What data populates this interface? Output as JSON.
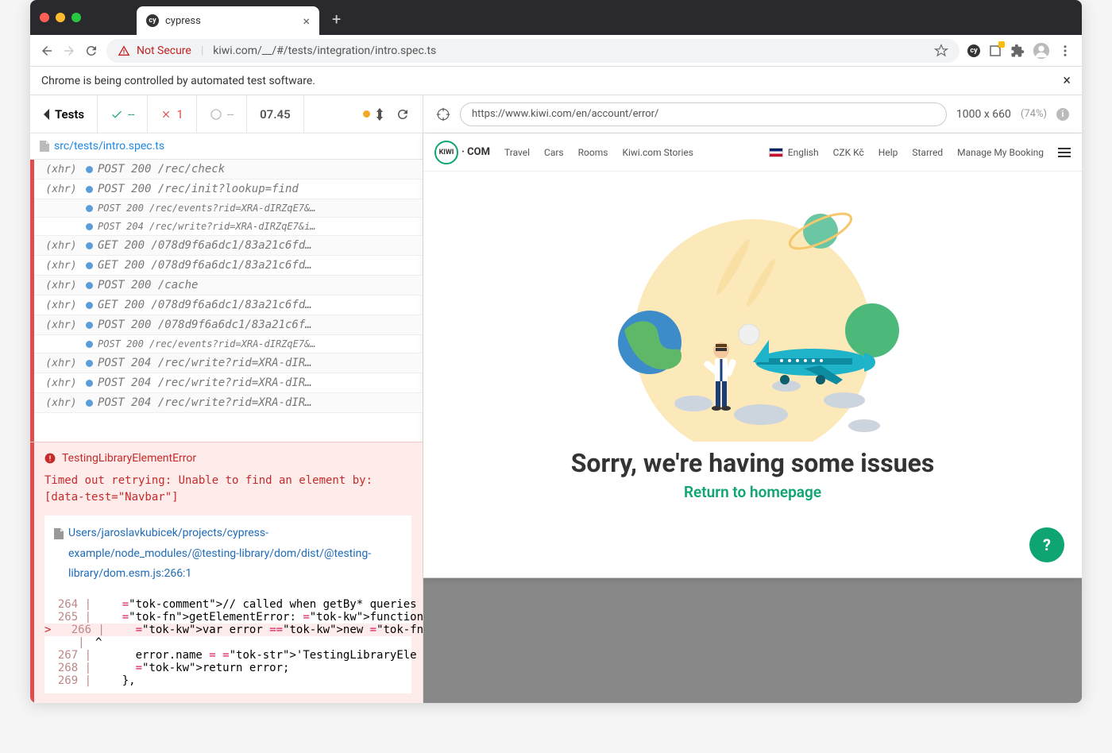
{
  "browser": {
    "tab_title": "cypress",
    "tab_favicon_text": "cy",
    "new_tab_symbol": "+",
    "close_symbol": "×",
    "url_prefix_warning": "Not Secure",
    "url": "kiwi.com/__/#/tests/integration/intro.spec.ts",
    "info_bar": "Chrome is being controlled by automated test software."
  },
  "cypress": {
    "back_label": "Tests",
    "passed": "--",
    "failed": "1",
    "pending": "--",
    "duration": "07.45",
    "spec_file": "src/tests/intro.spec.ts",
    "logs": [
      {
        "tag": "(xhr)",
        "text": "POST 200 /rec/check",
        "small": false
      },
      {
        "tag": "(xhr)",
        "text": "POST 200 /rec/init?lookup=find",
        "small": false
      },
      {
        "tag": "",
        "text": "POST 200 /rec/events?rid=XRA-dIRZqE7&…",
        "small": true
      },
      {
        "tag": "",
        "text": "POST 204 /rec/write?rid=XRA-dIRZqE7&i…",
        "small": true
      },
      {
        "tag": "(xhr)",
        "text": "GET 200 /078d9f6a6dc1/83a21c6fd…",
        "small": false
      },
      {
        "tag": "(xhr)",
        "text": "GET 200 /078d9f6a6dc1/83a21c6fd…",
        "small": false
      },
      {
        "tag": "(xhr)",
        "text": "POST 200 /cache",
        "small": false
      },
      {
        "tag": "(xhr)",
        "text": "GET 200 /078d9f6a6dc1/83a21c6fd…",
        "small": false
      },
      {
        "tag": "(xhr)",
        "text": "POST 200 /078d9f6a6dc1/83a21c6f…",
        "small": false
      },
      {
        "tag": "",
        "text": "POST 200 /rec/events?rid=XRA-dIRZqE7&…",
        "small": true
      },
      {
        "tag": "(xhr)",
        "text": "POST 204 /rec/write?rid=XRA-dIR…",
        "small": false
      },
      {
        "tag": "(xhr)",
        "text": "POST 204 /rec/write?rid=XRA-dIR…",
        "small": false
      },
      {
        "tag": "(xhr)",
        "text": "POST 204 /rec/write?rid=XRA-dIR…",
        "small": false
      }
    ],
    "error": {
      "name": "TestingLibraryElementError",
      "message": "Timed out retrying: Unable to find an element by: [data-test=\"Navbar\"]",
      "file": "Users/jaroslavkubicek/projects/cypress-example/node_modules/@testing-library/dom/dist/@testing-library/dom.esm.js:266:1",
      "code": [
        {
          "n": "264",
          "g": " | ",
          "c": "    // called when getBy* queries fai"
        },
        {
          "n": "265",
          "g": " | ",
          "c": "    getElementError: function getElem"
        },
        {
          "n": "266",
          "g": " | ",
          "c": "      var error = new Error([message,",
          "active": true
        },
        {
          "n": "",
          "g": " | ",
          "c": "^"
        },
        {
          "n": "267",
          "g": " | ",
          "c": "      error.name = 'TestingLibraryEle"
        },
        {
          "n": "268",
          "g": " | ",
          "c": "      return error;"
        },
        {
          "n": "269",
          "g": " | ",
          "c": "    },"
        }
      ]
    }
  },
  "preview": {
    "aut_url": "https://www.kiwi.com/en/account/error/",
    "dims": "1000 x 660",
    "pct": "(74%)",
    "nav": {
      "brand_inner": "KIWI",
      "brand_suffix": "· COM",
      "items": [
        "Travel",
        "Cars",
        "Rooms",
        "Kiwi.com Stories"
      ],
      "right": [
        "English",
        "CZK Kč",
        "Help",
        "Starred",
        "Manage My Booking"
      ]
    },
    "error_title": "Sorry, we're having some issues",
    "error_link": "Return to homepage",
    "help_symbol": "?"
  }
}
